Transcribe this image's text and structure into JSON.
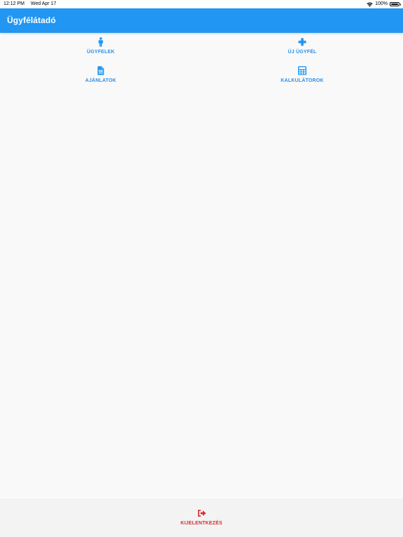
{
  "status_bar": {
    "time": "12:12 PM",
    "date": "Wed Apr 17",
    "battery": "100%",
    "wifi_icon": "wifi-icon",
    "battery_level": 1.0
  },
  "app_bar": {
    "title": "Ügyfélátadó"
  },
  "menu": {
    "items": [
      {
        "label": "ÜGYFELEK",
        "icon": "person-icon"
      },
      {
        "label": "ÚJ ÜGYFÉL",
        "icon": "plus-icon"
      },
      {
        "label": "AJÁNLATOK",
        "icon": "document-icon"
      },
      {
        "label": "KALKULÁTOROK",
        "icon": "calculator-icon"
      }
    ]
  },
  "bottom_bar": {
    "logout_label": "KIJELENTKEZÉS",
    "logout_icon": "sign-out-icon"
  },
  "colors": {
    "primary": "#2196f3",
    "accent_text": "#2a8fe6",
    "logout": "#d32f2f",
    "background": "#f9f9f9"
  }
}
